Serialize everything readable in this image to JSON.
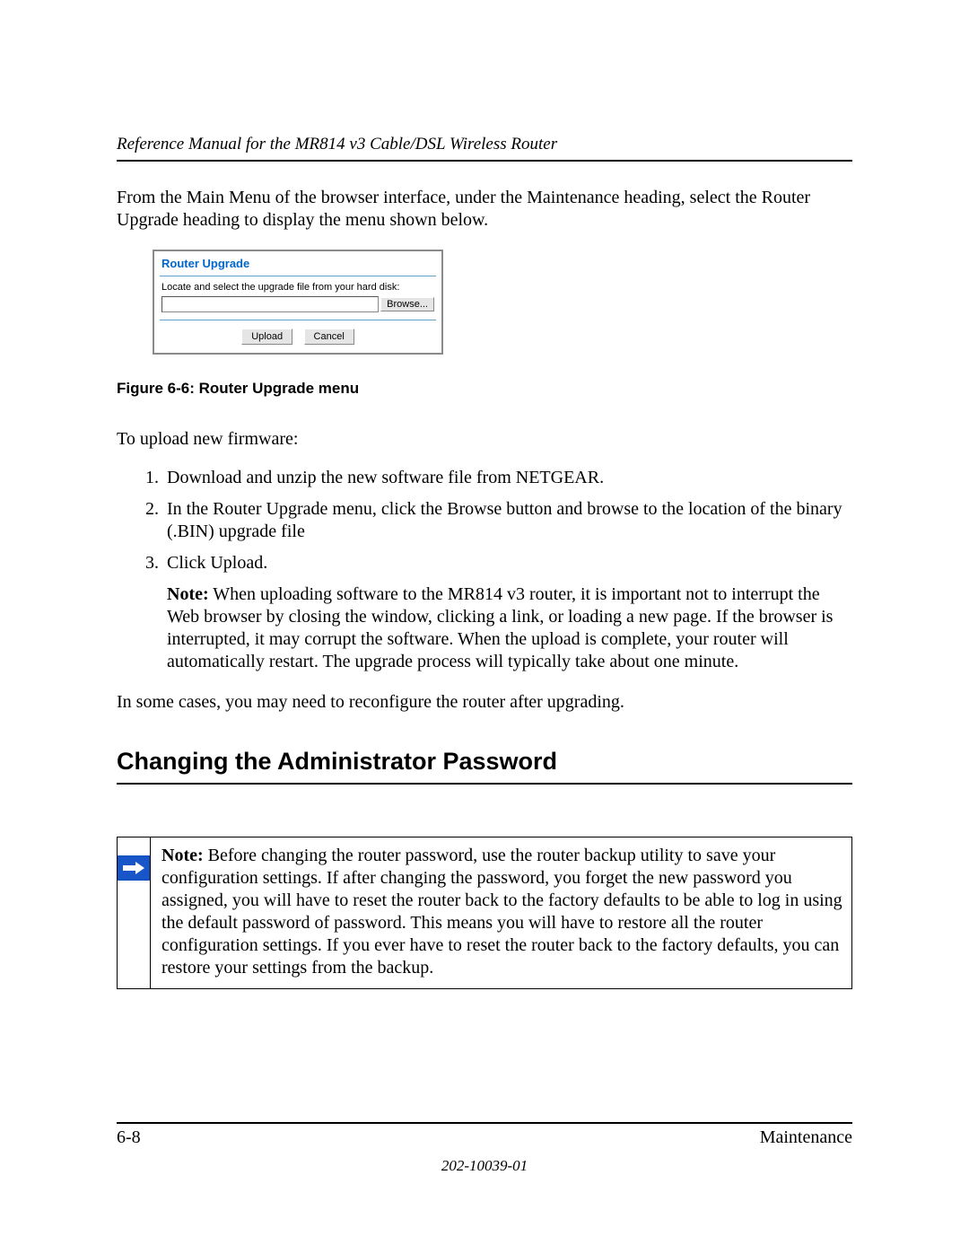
{
  "header": {
    "running_title": "Reference Manual for the MR814 v3 Cable/DSL Wireless Router"
  },
  "intro_para": "From the Main Menu of the browser interface, under the Maintenance heading, select the Router Upgrade heading to display the menu shown below.",
  "screenshot": {
    "title": "Router Upgrade",
    "label": "Locate and select the upgrade file from your hard disk:",
    "browse_btn": "Browse...",
    "upload_btn": "Upload",
    "cancel_btn": "Cancel"
  },
  "figure_caption": "Figure 6-6:  Router Upgrade menu",
  "upload_intro": "To upload new firmware:",
  "steps": {
    "s1": "Download and unzip the new software file from NETGEAR.",
    "s2": "In the Router Upgrade menu, click the Browse button and browse to the location of the binary (.BIN) upgrade file",
    "s3": "Click Upload.",
    "s3_note_lead": "Note:",
    "s3_note": " When uploading software to the MR814 v3 router, it is important not to interrupt the Web browser by closing the window, clicking a link, or loading a new page. If the browser is interrupted, it may corrupt the software. When the upload is complete, your router will automatically restart. The upgrade process will typically take about one minute."
  },
  "after_steps": "In some cases, you may need to reconfigure the router after upgrading.",
  "section_heading": "Changing the Administrator Password",
  "note_box": {
    "lead": "Note:",
    "body": " Before changing the router password, use the router backup utility to save your configuration settings. If after changing the password, you forget the new password you assigned, you will have to reset the router back to the factory defaults to be able to log in using the default password of password. This means you will have to restore all the router configuration settings. If you ever have to reset the router back to the factory defaults, you can restore your settings from the backup."
  },
  "footer": {
    "page_num": "6-8",
    "section": "Maintenance",
    "doc_num": "202-10039-01"
  }
}
